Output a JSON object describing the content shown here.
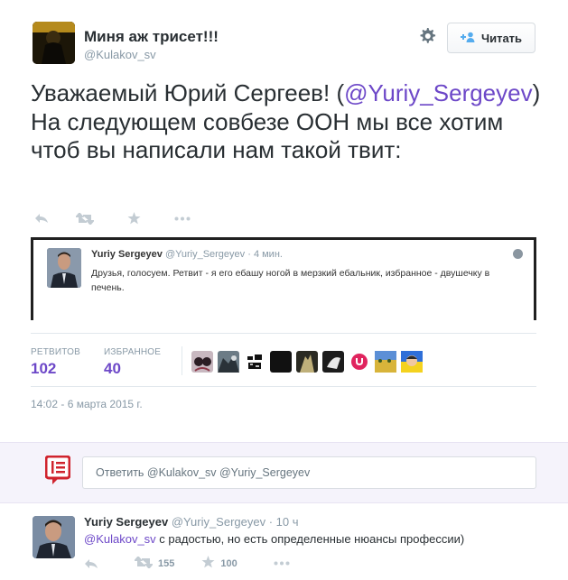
{
  "tweet": {
    "author_name": "Миня аж трисет!!!",
    "author_handle": "@Kulakov_sv",
    "follow_label": "Читать",
    "text_part1": "Уважаемый Юрий Сергеев! (",
    "mention": "@Yuriy_Sergeyev",
    "text_part2": ") На следующем совбезе ООН мы все хотим чтоб вы написали нам такой твит:"
  },
  "embedded_tweet": {
    "name": "Yuriy Sergeyev",
    "handle_time": "@Yuriy_Sergeyev · 4 мин.",
    "text": "Друзья, голосуем. Ретвит - я его ебашу ногой в мерзкий ебальник, избранное - двушечку в печень."
  },
  "stats": {
    "retweets_label": "РЕТВИТОВ",
    "retweets_value": "102",
    "favorites_label": "ИЗБРАННОЕ",
    "favorites_value": "40"
  },
  "timestamp": "14:02 - 6 марта 2015 г.",
  "reply_box": {
    "placeholder": "Ответить @Kulakov_sv @Yuriy_Sergeyev"
  },
  "reply": {
    "name": "Yuriy Sergeyev",
    "meta": "@Yuriy_Sergeyev · 10 ч",
    "mention": "@Kulakov_sv",
    "text": " с радостью, но есть определенные нюансы профессии)",
    "retweets": "155",
    "favorites": "100"
  },
  "colors": {
    "accent": "#6d48c8",
    "muted": "#8899a6",
    "reply_bg": "#f5f3fb"
  },
  "icons": [
    "gear-icon",
    "follow-user-icon",
    "reply-icon",
    "retweet-icon",
    "favorite-icon",
    "more-icon",
    "globe-icon",
    "compose-reply-icon"
  ]
}
